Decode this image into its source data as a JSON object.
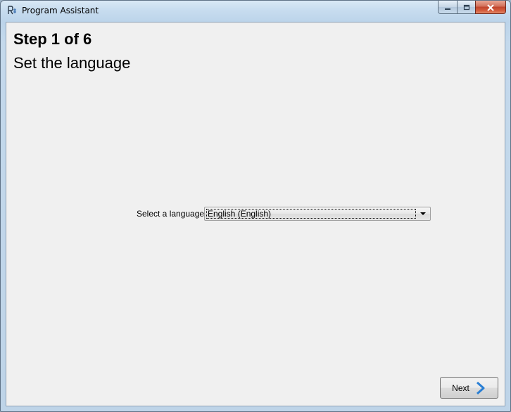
{
  "window": {
    "title": "Program Assistant"
  },
  "caption_buttons": {
    "minimize_icon": "minimize-icon",
    "maximize_icon": "maximize-icon",
    "close_icon": "close-icon"
  },
  "wizard": {
    "step_title": "Step 1 of 6",
    "step_subtitle": "Set the language"
  },
  "language": {
    "label": "Select a language",
    "selected": "English (English)"
  },
  "footer": {
    "next_label": "Next",
    "next_icon": "chevron-right-icon",
    "next_icon_color": "#2a7fd4"
  }
}
